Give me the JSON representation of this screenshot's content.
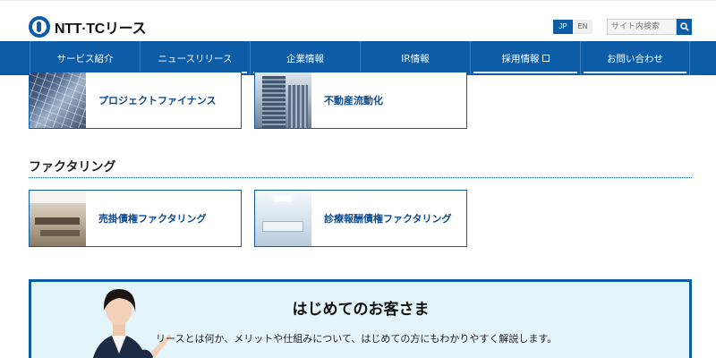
{
  "header": {
    "logo_text": "NTT·TCリース",
    "lang_jp": "JP",
    "lang_en": "EN",
    "search_placeholder": "サイト内検索"
  },
  "nav": {
    "items": [
      {
        "label": "サービス紹介"
      },
      {
        "label": "ニュースリリース"
      },
      {
        "label": "企業情報"
      },
      {
        "label": "IR情報"
      },
      {
        "label": "採用情報"
      },
      {
        "label": "お問い合わせ"
      }
    ]
  },
  "finance_cards": [
    {
      "label": "プロジェクトファイナンス",
      "icon": "solar-panel-photo"
    },
    {
      "label": "不動産流動化",
      "icon": "office-building-photo"
    }
  ],
  "factoring": {
    "title": "ファクタリング",
    "cards": [
      {
        "label": "売掛債権ファクタリング",
        "icon": "office-interior-photo"
      },
      {
        "label": "診療報酬債権ファクタリング",
        "icon": "hospital-room-photo"
      }
    ]
  },
  "banner": {
    "title": "はじめてのお客さま",
    "text": "リースとは何か、メリットや仕組みについて、はじめての方にもわかりやすく解説します。"
  },
  "colors": {
    "brand_blue": "#0d5ca8",
    "banner_bg": "#e4f4fb"
  }
}
